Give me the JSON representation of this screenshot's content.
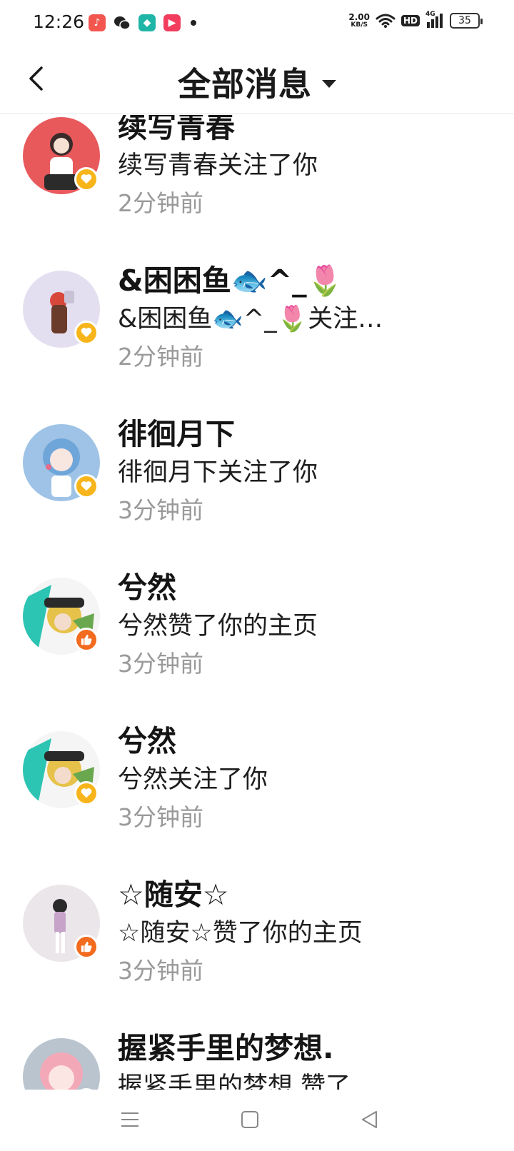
{
  "status_bar": {
    "time": "12:26",
    "net_speed_value": "2.00",
    "net_speed_unit": "KB/S",
    "hd_label": "HD",
    "network_type": "4G",
    "battery_level": "35",
    "notification_icons": [
      "music-app-icon",
      "wechat-icon",
      "game-app-icon",
      "video-app-icon"
    ]
  },
  "header": {
    "title": "全部消息",
    "back_icon": "back-arrow-icon",
    "dropdown_icon": "caret-down-icon"
  },
  "messages": [
    {
      "name": "续写青春",
      "text": "续写青春关注了你",
      "time": "2分钟前",
      "type": "follow"
    },
    {
      "name": "&困困鱼🐟^_🌷",
      "text": "&困困鱼🐟^_🌷关注…",
      "time": "2分钟前",
      "type": "follow"
    },
    {
      "name": "徘徊月下",
      "text": "徘徊月下关注了你",
      "time": "3分钟前",
      "type": "follow"
    },
    {
      "name": "兮然",
      "text": "兮然赞了你的主页",
      "time": "3分钟前",
      "type": "like"
    },
    {
      "name": "兮然",
      "text": "兮然关注了你",
      "time": "3分钟前",
      "type": "follow"
    },
    {
      "name": "☆随安☆",
      "text": "☆随安☆赞了你的主页",
      "time": "3分钟前",
      "type": "like"
    },
    {
      "name": "握紧手里的梦想.",
      "text": "握紧手里的梦想.赞了…",
      "time": "",
      "type": "like"
    }
  ],
  "nav_bar": {
    "icons": [
      "menu-icon",
      "home-icon",
      "back-icon"
    ]
  },
  "colors": {
    "follow_badge": "#f7b51b",
    "like_badge": "#f26b1e",
    "time_text": "#9a9a9a"
  }
}
